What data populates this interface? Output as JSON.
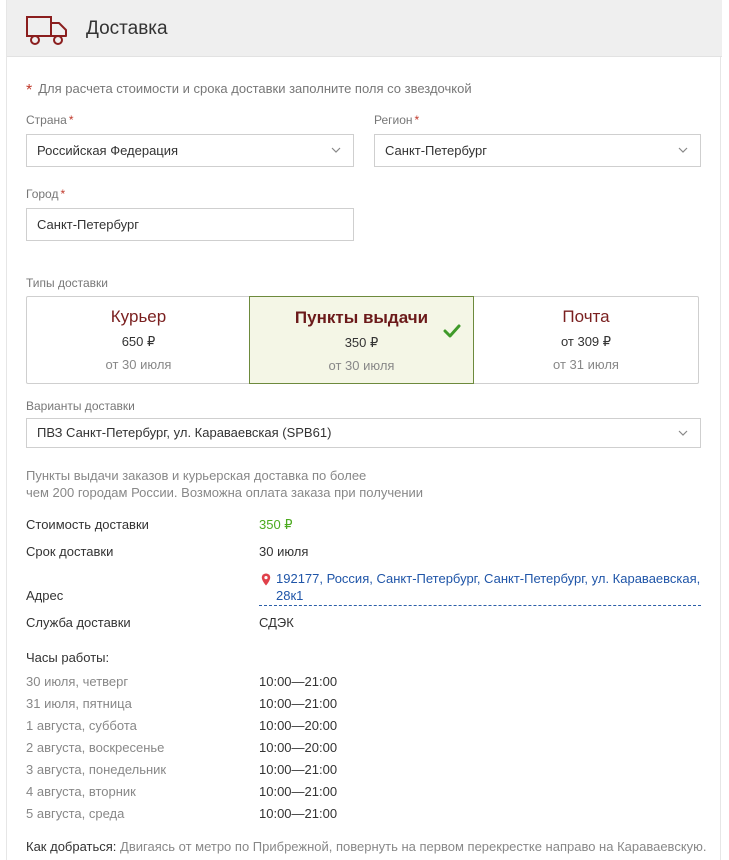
{
  "header": {
    "title": "Доставка",
    "icon": "truck-icon"
  },
  "note": "Для расчета стоимости и срока доставки заполните поля со звездочкой",
  "fields": {
    "country": {
      "label": "Страна",
      "value": "Российская Федерация"
    },
    "region": {
      "label": "Регион",
      "value": "Санкт-Петербург"
    },
    "city": {
      "label": "Город",
      "value": "Санкт-Петербург"
    }
  },
  "delivery_types": {
    "label": "Типы доставки",
    "items": [
      {
        "name": "Курьер",
        "price": "650 ₽",
        "date": "от 30 июля",
        "selected": false
      },
      {
        "name": "Пункты выдачи",
        "price": "350 ₽",
        "date": "от 30 июля",
        "selected": true
      },
      {
        "name": "Почта",
        "price": "от 309 ₽",
        "date": "от 31 июля",
        "selected": false
      }
    ]
  },
  "variants": {
    "label": "Варианты доставки",
    "value": "ПВЗ Санкт-Петербург, ул. Караваевская (SPB61)"
  },
  "info": {
    "line1": "Пункты выдачи заказов и курьерская доставка по более",
    "line2": "чем 200 городам России. Возможна оплата заказа при получении"
  },
  "details": {
    "cost_label": "Стоимость доставки",
    "cost_value": "350 ₽",
    "term_label": "Срок доставки",
    "term_value": "30 июля",
    "address_label": "Адрес",
    "address_line1": "192177, Россия, Санкт-Петербург, Санкт-Петербург, ул. Караваевская,",
    "address_line2": "28к1",
    "service_label": "Служба доставки",
    "service_value": "СДЭК"
  },
  "hours": {
    "title": "Часы работы:",
    "rows": [
      {
        "day": "30 июля, четверг",
        "time": "10:00—21:00"
      },
      {
        "day": "31 июля, пятница",
        "time": "10:00—21:00"
      },
      {
        "day": "1 августа, суббота",
        "time": "10:00—20:00"
      },
      {
        "day": "2 августа, воскресенье",
        "time": "10:00—20:00"
      },
      {
        "day": "3 августа, понедельник",
        "time": "10:00—21:00"
      },
      {
        "day": "4 августа, вторник",
        "time": "10:00—21:00"
      },
      {
        "day": "5 августа, среда",
        "time": "10:00—21:00"
      }
    ]
  },
  "howto": {
    "label": "Как добраться:",
    "text": "Двигаясь от метро по Прибрежной, повернуть на первом перекрестке направо на Караваевскую."
  },
  "colors": {
    "accent": "#7a1f1f",
    "selected_border": "#6d8a3c",
    "selected_bg": "#f4f6e6",
    "green": "#4caa1f",
    "link": "#1f55a8",
    "required": "#c0392b"
  }
}
